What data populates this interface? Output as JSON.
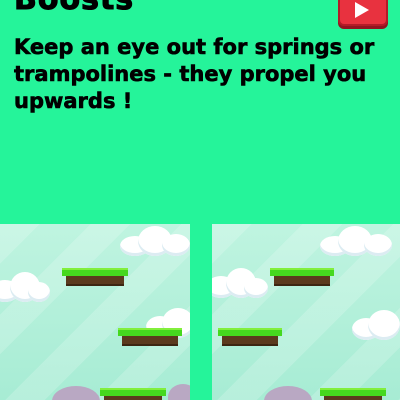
{
  "header": {
    "title": "Boosts"
  },
  "tip": {
    "text": "Keep an eye out for springs or trampolines - they propel you upwards !"
  },
  "icons": {
    "next": "play-triangle-icon"
  },
  "colors": {
    "background": "#25f49a",
    "button": "#e8323f",
    "sky": "#bff4e0",
    "grass": "#45d81f",
    "dirt": "#5b3a1e"
  }
}
